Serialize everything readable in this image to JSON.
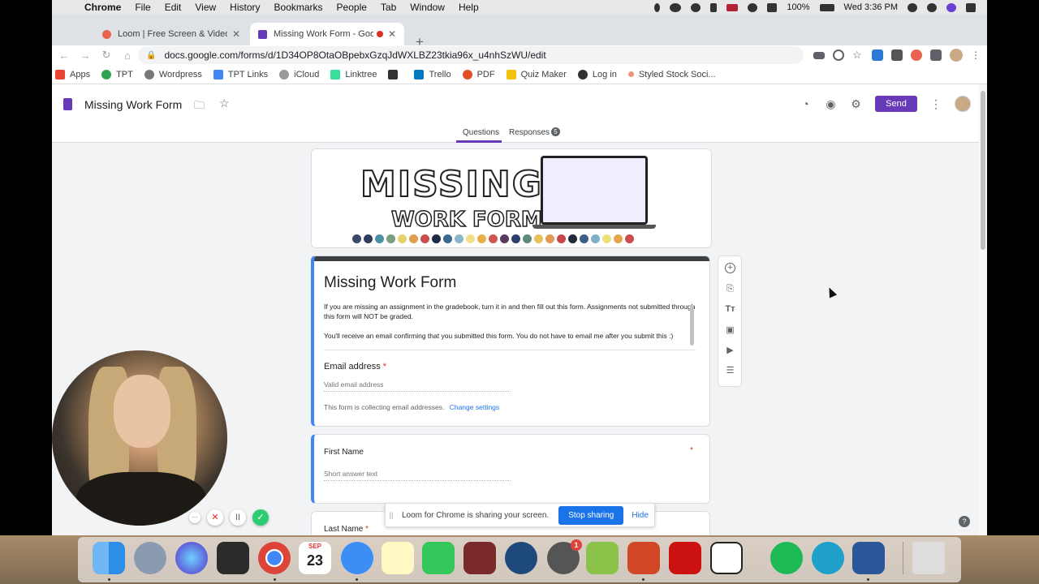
{
  "menubar": {
    "apple": "",
    "items": [
      "Chrome",
      "File",
      "Edit",
      "View",
      "History",
      "Bookmarks",
      "People",
      "Tab",
      "Window",
      "Help"
    ],
    "battery": "100%",
    "clock": "Wed 3:36 PM"
  },
  "browser": {
    "tabs": [
      {
        "label": "Loom | Free Screen & Video Re",
        "favicon_color": "#e8624d"
      },
      {
        "label": "Missing Work Form - Goog",
        "favicon_color": "#673ab7"
      }
    ],
    "new_tab": "+",
    "url": "docs.google.com/forms/d/1D34OP8OtaOBpebxGzqJdWXLBZ23tkia96x_u4nhSzWU/edit",
    "bookmarks": [
      {
        "label": "Apps",
        "color": "#ea4335"
      },
      {
        "label": "TPT",
        "color": "#2ea44f"
      },
      {
        "label": "Wordpress",
        "color": "#21759b"
      },
      {
        "label": "TPT Links",
        "color": "#4285f4"
      },
      {
        "label": "iCloud",
        "color": "#999999"
      },
      {
        "label": "Linktree",
        "color": "#39e09b"
      },
      {
        "label": "",
        "color": "#333333"
      },
      {
        "label": "Trello",
        "color": "#0079bf"
      },
      {
        "label": "PDF",
        "color": "#e44d26"
      },
      {
        "label": "Quiz Maker",
        "color": "#f4c20d"
      },
      {
        "label": "Log in",
        "color": "#333333"
      },
      {
        "label": "Styled Stock Soci...",
        "color": "#e89a7a"
      }
    ]
  },
  "forms": {
    "doc_title": "Missing Work Form",
    "send_label": "Send",
    "tabs": {
      "questions": "Questions",
      "responses": "Responses",
      "responses_count": "5"
    },
    "banner": {
      "line1": "MISSING",
      "line2": "WORK FORM"
    },
    "title_card": {
      "title": "Missing Work Form",
      "desc_p1": "If you are missing an assignment in the gradebook, turn it in and then fill out this form. Assignments not submitted through this form will NOT be graded.",
      "desc_p2": "You'll receive an email confirming that you submitted this form. You do not have to email me after you submit this :)",
      "email_label": "Email address",
      "required_mark": "*",
      "email_placeholder": "Valid email address",
      "collect_note": "This form is collecting email addresses.",
      "change_settings": "Change settings"
    },
    "first_name_card": {
      "label": "First Name",
      "required_mark": "*",
      "placeholder": "Short answer text"
    },
    "last_name_card": {
      "label": "Last Name",
      "required_mark": "*"
    },
    "toolbar_icons": [
      "add-question-icon",
      "import-questions-icon",
      "add-title-icon",
      "add-image-icon",
      "add-video-icon",
      "add-section-icon"
    ]
  },
  "share_bar": {
    "grip": "||",
    "text": "Loom for Chrome is sharing your screen.",
    "stop": "Stop sharing",
    "hide": "Hide"
  },
  "help": "?",
  "recording": {
    "pause": "II",
    "cancel": "✕",
    "done": "✓",
    "more": "···"
  },
  "dock": {
    "calendar_month": "SEP",
    "calendar_day": "23",
    "facetime_badge": "1"
  }
}
